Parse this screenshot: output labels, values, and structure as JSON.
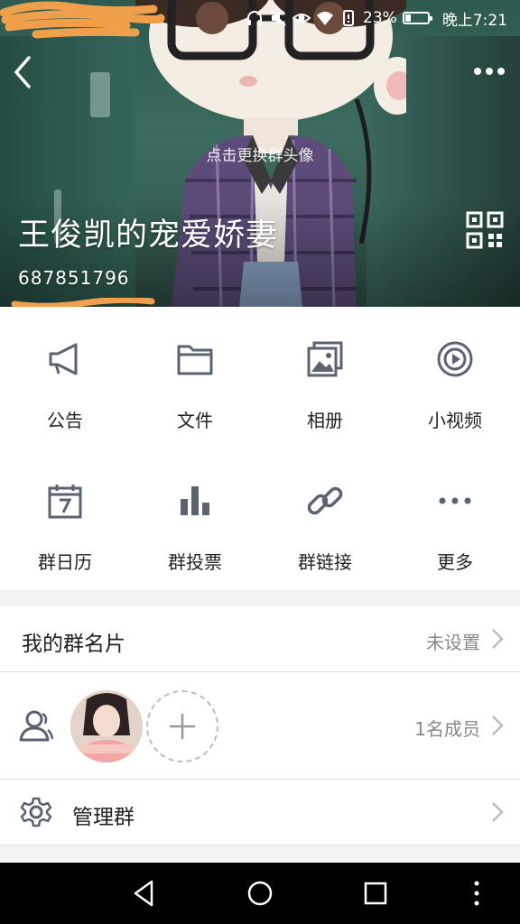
{
  "status_bar": {
    "battery_percent": "23%",
    "time": "晚上7:21"
  },
  "header": {
    "change_avatar_label": "点击更换群头像",
    "group_name": "王俊凯的宠爱娇妻",
    "group_id": "687851796"
  },
  "features": [
    {
      "label": "公告",
      "icon": "megaphone-icon"
    },
    {
      "label": "文件",
      "icon": "folder-icon"
    },
    {
      "label": "相册",
      "icon": "photo-album-icon"
    },
    {
      "label": "小视频",
      "icon": "video-play-icon"
    },
    {
      "label": "群日历",
      "icon": "calendar-icon"
    },
    {
      "label": "群投票",
      "icon": "bar-chart-icon"
    },
    {
      "label": "群链接",
      "icon": "link-icon"
    },
    {
      "label": "更多",
      "icon": "more-dots-icon"
    }
  ],
  "group_card": {
    "label": "我的群名片",
    "value": "未设置"
  },
  "members": {
    "count_label": "1名成员"
  },
  "manage": {
    "label": "管理群"
  },
  "colors": {
    "icon_gray": "#5b6270",
    "scribble_orange": "#f0a04b"
  }
}
